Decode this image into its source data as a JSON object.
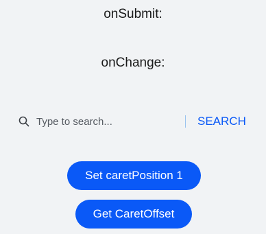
{
  "labels": {
    "on_submit": "onSubmit:",
    "on_change": "onChange:"
  },
  "search": {
    "icon": "search-icon",
    "placeholder": "Type to search...",
    "value": "",
    "button_label": "SEARCH"
  },
  "buttons": {
    "set_caret_position": "Set caretPosition 1",
    "get_caret_offset": "Get CaretOffset"
  },
  "colors": {
    "accent": "#0a59f7",
    "background": "#f1f3f5",
    "divider": "#9bc3ef",
    "text": "#1a1a1a"
  }
}
